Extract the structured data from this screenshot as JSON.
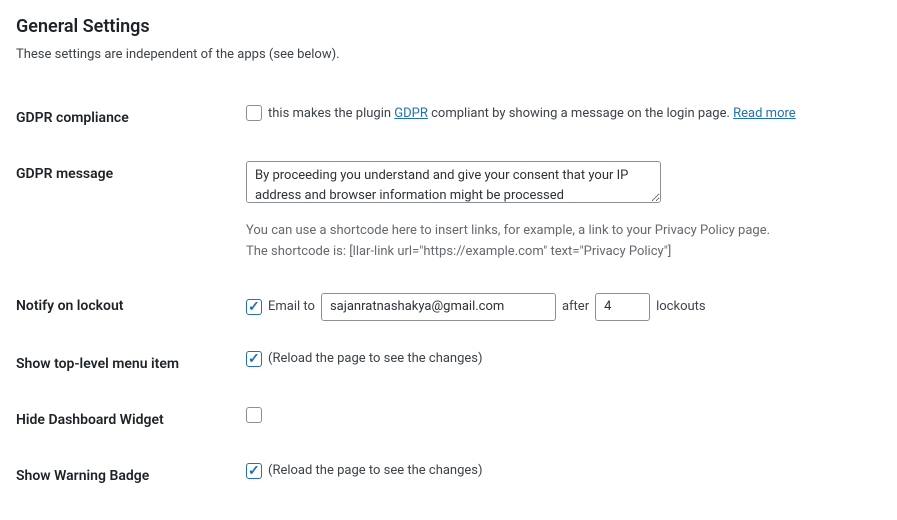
{
  "section": {
    "title": "General Settings",
    "description": "These settings are independent of the apps (see below)."
  },
  "gdpr_compliance": {
    "label": "GDPR compliance",
    "checked": false,
    "text_before": "this makes the plugin ",
    "link1_text": "GDPR",
    "text_middle": " compliant by showing a message on the login page. ",
    "link2_text": "Read more"
  },
  "gdpr_message": {
    "label": "GDPR message",
    "value": "By proceeding you understand and give your consent that your IP address and browser information might be processed",
    "hint_line1": "You can use a shortcode here to insert links, for example, a link to your Privacy Policy page.",
    "hint_line2": "The shortcode is: [llar-link url=\"https://example.com\" text=\"Privacy Policy\"]"
  },
  "notify_lockout": {
    "label": "Notify on lockout",
    "checked": true,
    "text_email_to": "Email to",
    "email_value": "sajanratnashakya@gmail.com",
    "text_after": "after",
    "number_value": "4",
    "text_lockouts": "lockouts"
  },
  "show_top_menu": {
    "label": "Show top-level menu item",
    "checked": true,
    "note": "(Reload the page to see the changes)"
  },
  "hide_dashboard": {
    "label": "Hide Dashboard Widget",
    "checked": false
  },
  "show_warning_badge": {
    "label": "Show Warning Badge",
    "checked": true,
    "note": "(Reload the page to see the changes)"
  }
}
